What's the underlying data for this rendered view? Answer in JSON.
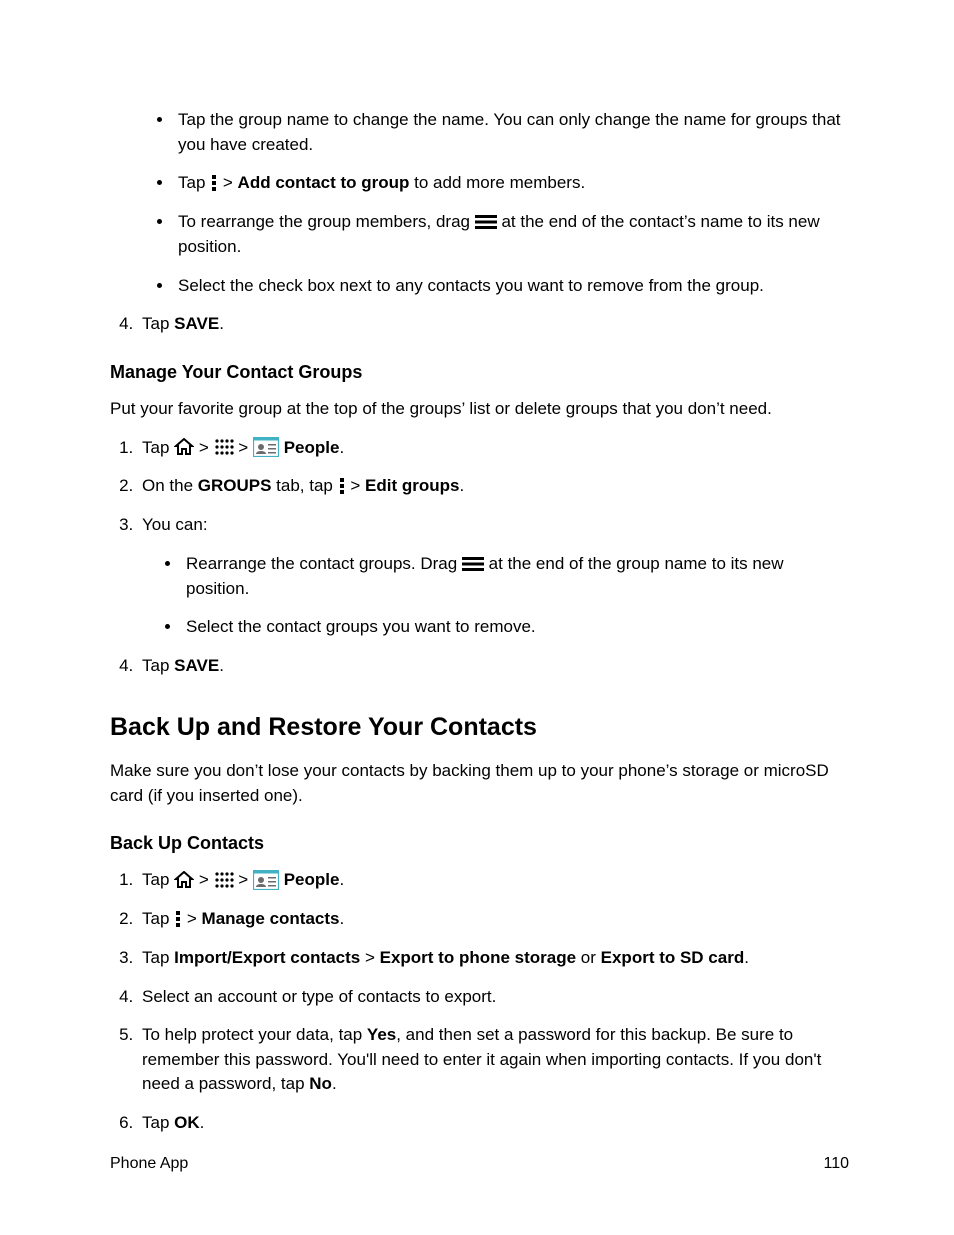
{
  "top_bullets": [
    {
      "text": "Tap the group name to change the name. You can only change the name for groups that you have created."
    },
    {
      "prefix": "Tap ",
      "bold_after_icon": "Add contact to group",
      "suffix": " to add more members.",
      "icon_menu": true
    },
    {
      "prefix": "To rearrange the group members, drag ",
      "suffix": " at the end of the contact’s name to its new position.",
      "icon_drag": true
    },
    {
      "text": "Select the check box next to any contacts you want to remove from the group."
    }
  ],
  "top_step4": {
    "prefix": "Tap ",
    "bold": "SAVE",
    "suffix": "."
  },
  "manage_heading": "Manage Your Contact Groups",
  "manage_intro": "Put your favorite group at the top of the groups’ list or delete groups that you don’t need.",
  "manage_steps": {
    "s1": {
      "prefix": "Tap ",
      "people": "People",
      "suffix": "."
    },
    "s2": {
      "prefix": "On the ",
      "groups": "GROUPS",
      "mid": " tab, tap ",
      "edit": "Edit groups",
      "suffix": "."
    },
    "s3_text": "You can:",
    "s3_bullets": [
      {
        "prefix": "Rearrange the contact groups. Drag ",
        "suffix": " at the end of the group name to its new position."
      },
      {
        "text": "Select the contact groups you want to remove."
      }
    ],
    "s4": {
      "prefix": "Tap ",
      "bold": "SAVE",
      "suffix": "."
    }
  },
  "backup_heading": "Back Up and Restore Your Contacts",
  "backup_intro": "Make sure you don’t lose your contacts by backing them up to your phone’s storage or microSD card (if you inserted one).",
  "backup_sub": "Back Up Contacts",
  "backup_steps": {
    "s1": {
      "prefix": "Tap ",
      "people": "People",
      "suffix": "."
    },
    "s2": {
      "prefix": "Tap ",
      "bold": "Manage contacts",
      "suffix": "."
    },
    "s3": {
      "prefix": "Tap ",
      "b1": "Import/Export contacts",
      "mid1": " > ",
      "b2": "Export to phone storage",
      "mid2": " or ",
      "b3": "Export to SD card",
      "suffix": "."
    },
    "s4": "Select an account or type of contacts to export.",
    "s5": {
      "p1": "To help protect your data, tap ",
      "yes": "Yes",
      "p2": ", and then set a password for this backup. Be sure to remember this password. You'll need to enter it again when importing contacts. If you don't need a password, tap ",
      "no": "No",
      "p3": "."
    },
    "s6": {
      "prefix": "Tap ",
      "bold": "OK",
      "suffix": "."
    }
  },
  "footer_left": "Phone App",
  "footer_right": "110",
  "gt": ">"
}
